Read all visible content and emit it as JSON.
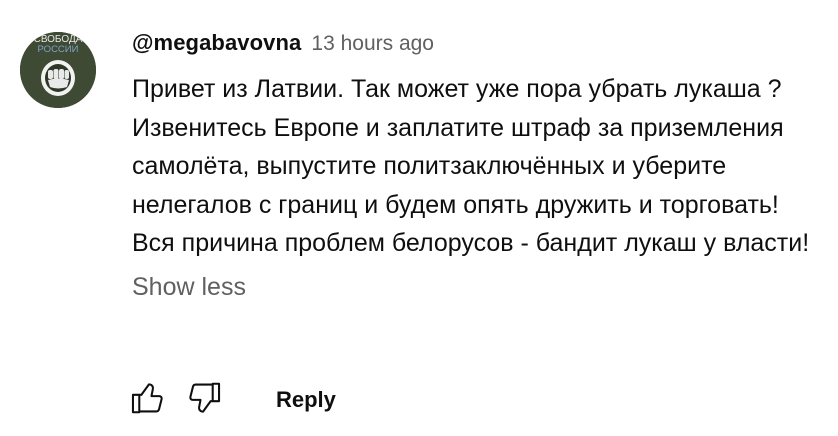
{
  "comment": {
    "avatar_text": {
      "line1": "СВОБОДА",
      "line2": "РОССИИ"
    },
    "author": "@megabavovna",
    "timestamp": "13 hours ago",
    "text": "Привет из Латвии. Так может уже пора убрать лукаша ? Извенитесь Европе и заплатите штраф за приземления самолёта, выпустите политзаключённых и уберите нелегалов с границ и будем опять дружить и торговать! Вся причина проблем белорусов - бандит лукаш у власти!",
    "show_less_label": "Show less",
    "reply_label": "Reply"
  },
  "icons": {
    "like": "thumbs-up-icon",
    "dislike": "thumbs-down-icon"
  },
  "colors": {
    "text": "#0f0f0f",
    "secondary": "#606060",
    "avatar_bg": "#3e4a33",
    "avatar_accent": "#7ea3c4"
  }
}
